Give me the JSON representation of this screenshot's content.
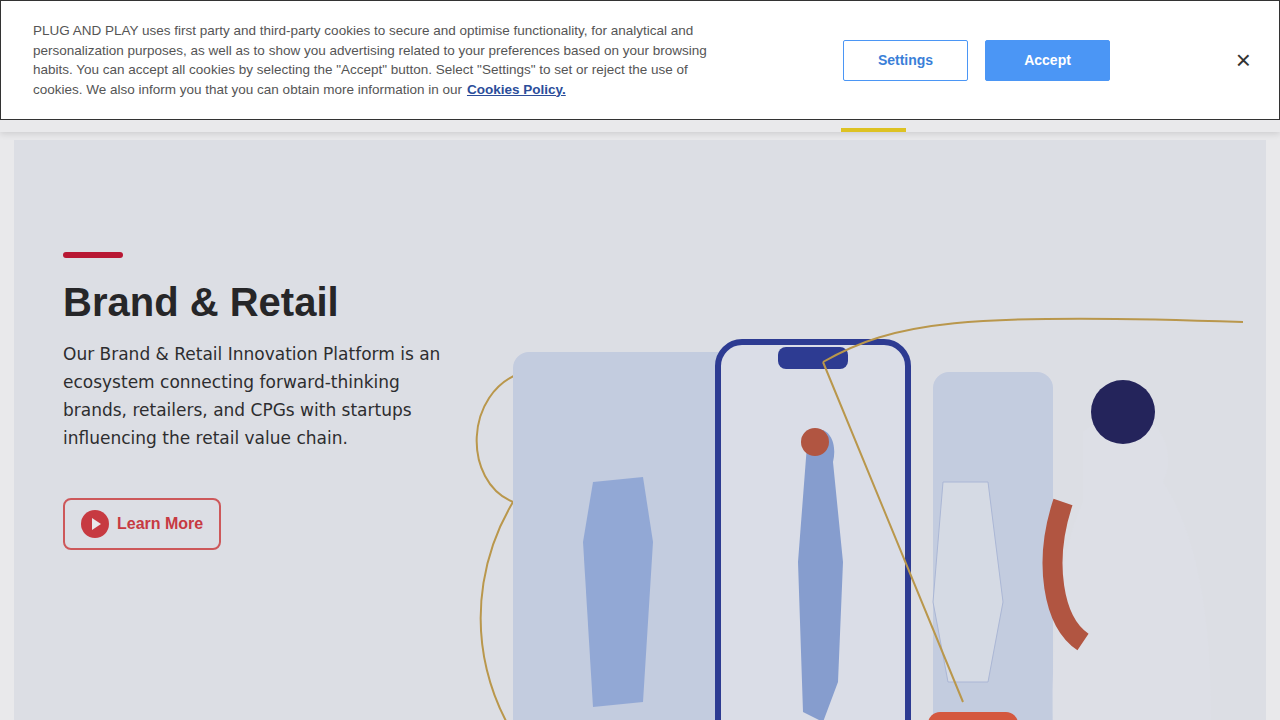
{
  "cookie_banner": {
    "text": "PLUG AND PLAY uses first party and third-party cookies to secure and optimise functionality, for analytical and personalization purposes, as well as to show you advertising related to your preferences based on your browsing habits. You can accept all cookies by selecting the \"Accept\" button. Select \"Settings\" to set or reject the use of cookies. We also inform you that you can obtain more information in our",
    "link": "Cookies Policy.",
    "buttons": [
      "Settings",
      "Accept"
    ],
    "close": "×"
  },
  "hero": {
    "title": "Brand & Retail",
    "description": "Our Brand & Retail Innovation Platform is an ecosystem connecting forward-thinking brands, retailers, and CPGs with startups influencing the retail value chain.",
    "button": "Learn More"
  }
}
